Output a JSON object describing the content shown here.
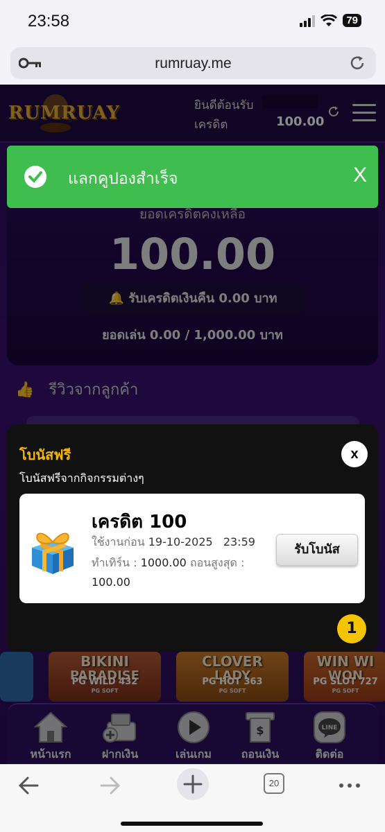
{
  "status_bar": {
    "time": "23:58",
    "battery": "79"
  },
  "browser": {
    "url": "rumruay.me",
    "tab_count": "20"
  },
  "header": {
    "logo": "RUMRUAY",
    "welcome": "ยินดีต้อนรับ",
    "credit_label": "เครดิต",
    "credit_value": "100.00"
  },
  "balance": {
    "label": "ยอดเครดิตคงเหลือ",
    "value": "100.00",
    "cashback": "รับเครดิตเงินคืน  0.00  บาท",
    "play_amount": "ยอดเล่น 0.00 / 1,000.00 บาท"
  },
  "reviews": {
    "title": "รีวิวจากลูกค้า"
  },
  "games": [
    {
      "title1": "BIKINI",
      "title2": "PARADISE",
      "tag": "PG WILD 432",
      "provider": "PG SOFT"
    },
    {
      "title1": "CLOVER",
      "title2": "LADY",
      "tag": "PG HOT 363",
      "provider": "PG SOFT"
    },
    {
      "title1": "WIN WI",
      "title2": "WON",
      "tag": "PG SLOT 727",
      "provider": "PG SOFT"
    }
  ],
  "bottom_nav": [
    {
      "label": "หน้าแรก",
      "icon": "home-icon"
    },
    {
      "label": "ฝากเงิน",
      "icon": "deposit-icon"
    },
    {
      "label": "เล่นเกม",
      "icon": "play-icon"
    },
    {
      "label": "ถอนเงิน",
      "icon": "withdraw-icon"
    },
    {
      "label": "ติดต่อ",
      "icon": "line-icon"
    }
  ],
  "toast": {
    "message": "แลกคูปองสำเร็จ",
    "close": "X"
  },
  "modal": {
    "title": "โบนัสฟรี",
    "subtitle": "โบนัสฟรีจากกิจกรรมต่างๆ",
    "close": "x",
    "badge_count": "1",
    "bonus": {
      "name": "เครดิต 100",
      "expiry_label": "ใช้งานก่อน",
      "expiry_date": "19-10-2025",
      "expiry_time": "23:59",
      "turnover_label": "ทำเทิร์น :",
      "turnover_value": "1000.00",
      "max_withdraw_label": "ถอนสูงสุด :",
      "max_withdraw_value": "100.00",
      "claim_label": "รับโบนัส"
    }
  },
  "colors": {
    "accent": "#f5b800",
    "toast": "#3fbd4f",
    "background": "#2a0d55"
  }
}
